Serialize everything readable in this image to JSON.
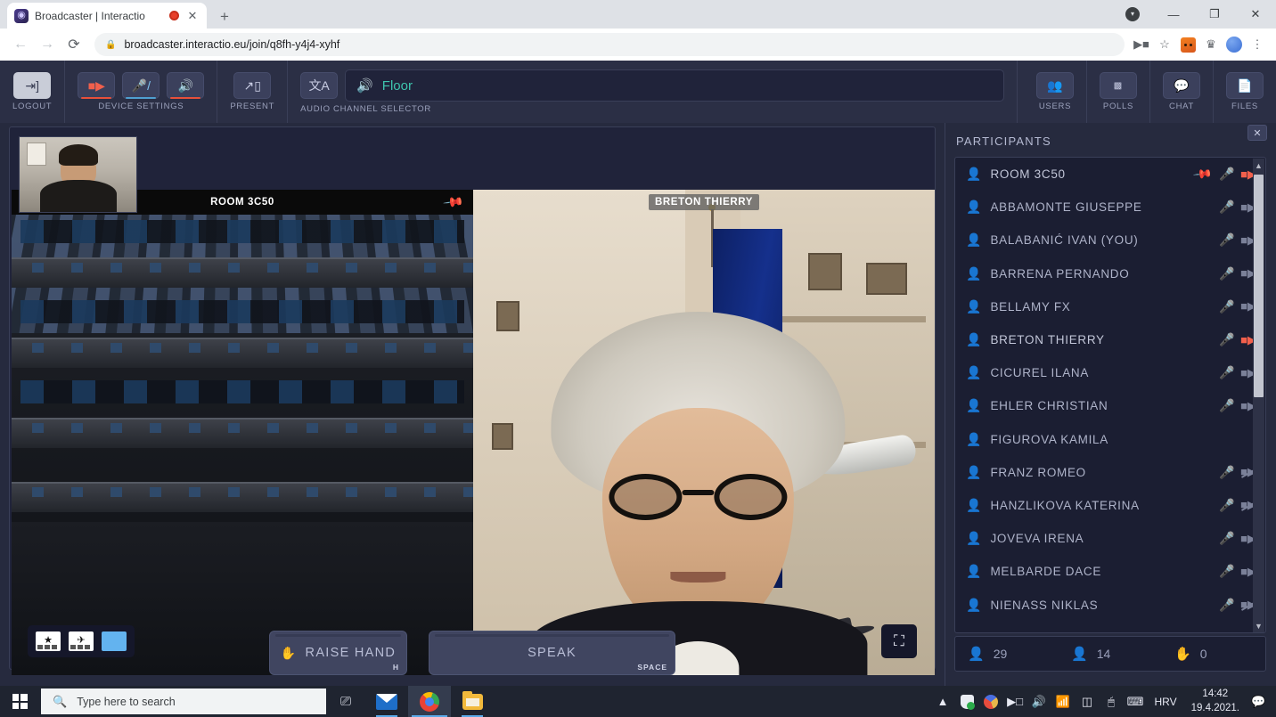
{
  "browser": {
    "tab": {
      "title": "Broadcaster | Interactio",
      "favicon": "interactio-logo-icon",
      "recording": "recording-indicator-icon",
      "close": "✕"
    },
    "new_tab": "+",
    "window": {
      "profile": "▾",
      "minimize": "—",
      "maximize": "❐",
      "close": "✕"
    },
    "nav": {
      "back": "←",
      "forward": "→",
      "reload": "⟳"
    },
    "omnibox": {
      "lock": "🔒",
      "url": "broadcaster.interactio.eu/join/q8fh-y4j4-xyhf"
    },
    "toolbar_icons": [
      "camera-icon",
      "bookmark-star-icon",
      "metamask-extension-icon",
      "extensions-puzzle-icon",
      "profile-avatar-icon",
      "chrome-menu-icon"
    ]
  },
  "app": {
    "toolbar": {
      "logout": {
        "label": "LOGOUT",
        "icon": "logout-icon"
      },
      "device_settings": {
        "label": "DEVICE SETTINGS",
        "camera": {
          "icon": "camera-icon",
          "state": "on",
          "color": "#f2604c"
        },
        "microphone": {
          "icon": "microphone-muted-icon",
          "state": "muted",
          "color": "#7fc4ef"
        },
        "speaker": {
          "icon": "speaker-icon",
          "state": "on",
          "color": "#f2604c"
        }
      },
      "present": {
        "label": "PRESENT",
        "icon": "present-screen-icon"
      },
      "audio_channel": {
        "label": "AUDIO CHANNEL SELECTOR",
        "language_icon": "language-translate-icon",
        "speaker_icon": "speaker-icon",
        "selected": "Floor",
        "color": "#3ec4ad"
      },
      "users": {
        "label": "USERS",
        "icon": "users-icon"
      },
      "polls": {
        "label": "POLLS",
        "icon": "polls-grid-icon"
      },
      "chat": {
        "label": "CHAT",
        "icon": "chat-bubble-icon"
      },
      "files": {
        "label": "FILES",
        "icon": "file-document-icon"
      }
    },
    "stage": {
      "self_view": "self-view-thumbnail",
      "tiles": [
        {
          "name": "ROOM 3C50",
          "pinned": true,
          "pin_icon": "pin-icon",
          "style": "plain"
        },
        {
          "name": "BRETON THIERRY",
          "pinned": false,
          "style": "badge"
        }
      ],
      "layout_buttons": [
        {
          "name": "speaker-view",
          "glyph": "★"
        },
        {
          "name": "pinned-view",
          "glyph": "✈"
        },
        {
          "name": "grid-view",
          "glyph": "",
          "active": true
        }
      ],
      "fullscreen": {
        "icon": "fullscreen-expand-icon",
        "glyph": "⛶"
      }
    },
    "actions": {
      "raise_hand": {
        "label": "RAISE HAND",
        "shortcut": "H",
        "icon": "raise-hand-icon"
      },
      "speak": {
        "label": "SPEAK",
        "shortcut": "SPACE"
      }
    },
    "panel": {
      "title": "PARTICIPANTS",
      "close": "✕",
      "participants": [
        {
          "name": "ROOM 3C50",
          "active": true,
          "pinned": true,
          "mic": "on",
          "camera": "on"
        },
        {
          "name": "ABBAMONTE GIUSEPPE",
          "active": false,
          "pinned": false,
          "mic": "off",
          "camera": "off"
        },
        {
          "name": "BALABANIĆ IVAN (YOU)",
          "active": false,
          "pinned": false,
          "mic": "off",
          "camera": "off"
        },
        {
          "name": "BARRENA PERNANDO",
          "active": false,
          "pinned": false,
          "mic": "off",
          "camera": "off"
        },
        {
          "name": "BELLAMY FX",
          "active": false,
          "pinned": false,
          "mic": "off",
          "camera": "off"
        },
        {
          "name": "BRETON THIERRY",
          "active": true,
          "pinned": false,
          "mic": "on",
          "camera": "on"
        },
        {
          "name": "CICUREL ILANA",
          "active": false,
          "pinned": false,
          "mic": "off",
          "camera": "off"
        },
        {
          "name": "EHLER CHRISTIAN",
          "active": false,
          "pinned": false,
          "mic": "off",
          "camera": "off"
        },
        {
          "name": "FIGUROVA KAMILA",
          "active": false,
          "pinned": false,
          "mic": "none",
          "camera": "none"
        },
        {
          "name": "FRANZ ROMEO",
          "active": false,
          "pinned": false,
          "mic": "off",
          "camera": "disabled"
        },
        {
          "name": "HANZLIKOVA KATERINA",
          "active": false,
          "pinned": false,
          "mic": "off",
          "camera": "disabled"
        },
        {
          "name": "JOVEVA IRENA",
          "active": false,
          "pinned": false,
          "mic": "off",
          "camera": "off"
        },
        {
          "name": "MELBARDE DACE",
          "active": false,
          "pinned": false,
          "mic": "off",
          "camera": "off"
        },
        {
          "name": "NIENASS NIKLAS",
          "active": false,
          "pinned": false,
          "mic": "off",
          "camera": "disabled"
        }
      ],
      "counters": [
        {
          "icon": "participant-icon",
          "value": "29"
        },
        {
          "icon": "participant-icon",
          "value": "14"
        },
        {
          "icon": "raise-hand-icon",
          "value": "0"
        }
      ]
    }
  },
  "taskbar": {
    "start": "start-button",
    "search_placeholder": "Type here to search",
    "task_view": "task-view-icon",
    "apps": [
      {
        "name": "mail-app",
        "state": "open"
      },
      {
        "name": "chrome-app",
        "state": "active"
      },
      {
        "name": "file-explorer-app",
        "state": "open"
      }
    ],
    "tray": {
      "overflow": "▲",
      "icons": [
        "security-shield-icon",
        "app-tray-icon",
        "camera-tray-icon",
        "volume-icon",
        "wifi-icon",
        "battery-icon",
        "mouse-icon",
        "keyboard-icon"
      ],
      "language": "HRV",
      "time": "14:42",
      "date": "19.4.2021.",
      "notifications": "notification-icon"
    }
  }
}
